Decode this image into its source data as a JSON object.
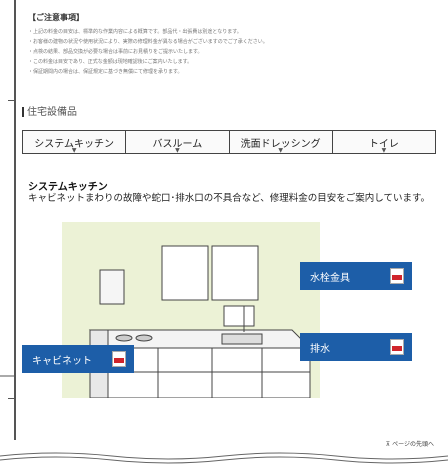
{
  "notes": {
    "title": "【ご注意事項】",
    "lines": [
      "・上記の料金の目安は、標準的な作業内容による概算です。部品代・出張費は別途となります。",
      "・お客様の建物の状況や使用状況により、実際の修理料金が異なる場合がございますのでご了承ください。",
      "・点検の結果、部品交換が必要な場合は事前にお見積りをご提示いたします。",
      "・この料金は目安であり、正式な金額は現地確認後にご案内いたします。",
      "・保証期間内の場合は、保証規定に基づき無償にて修理を承ります。"
    ]
  },
  "section": {
    "heading": "住宅設備品"
  },
  "tabs": [
    {
      "label": "システムキッチン"
    },
    {
      "label": "バスルーム"
    },
    {
      "label": "洗面ドレッシング"
    },
    {
      "label": "トイレ"
    }
  ],
  "category": {
    "title": "システムキッチン",
    "description": "キャビネットまわりの故障や蛇口･排水口の不具合など、修理料金の目安をご案内しています。"
  },
  "callouts": {
    "cabinet": "キャビネット",
    "faucet": "水栓金具",
    "drain": "排水"
  },
  "footer": {
    "page_top": "ページの先頭へ"
  },
  "colors": {
    "callout_bg": "#1d5ea8",
    "illustration_bg": "#ecf2d6",
    "pdf_icon": "#d0242b"
  }
}
